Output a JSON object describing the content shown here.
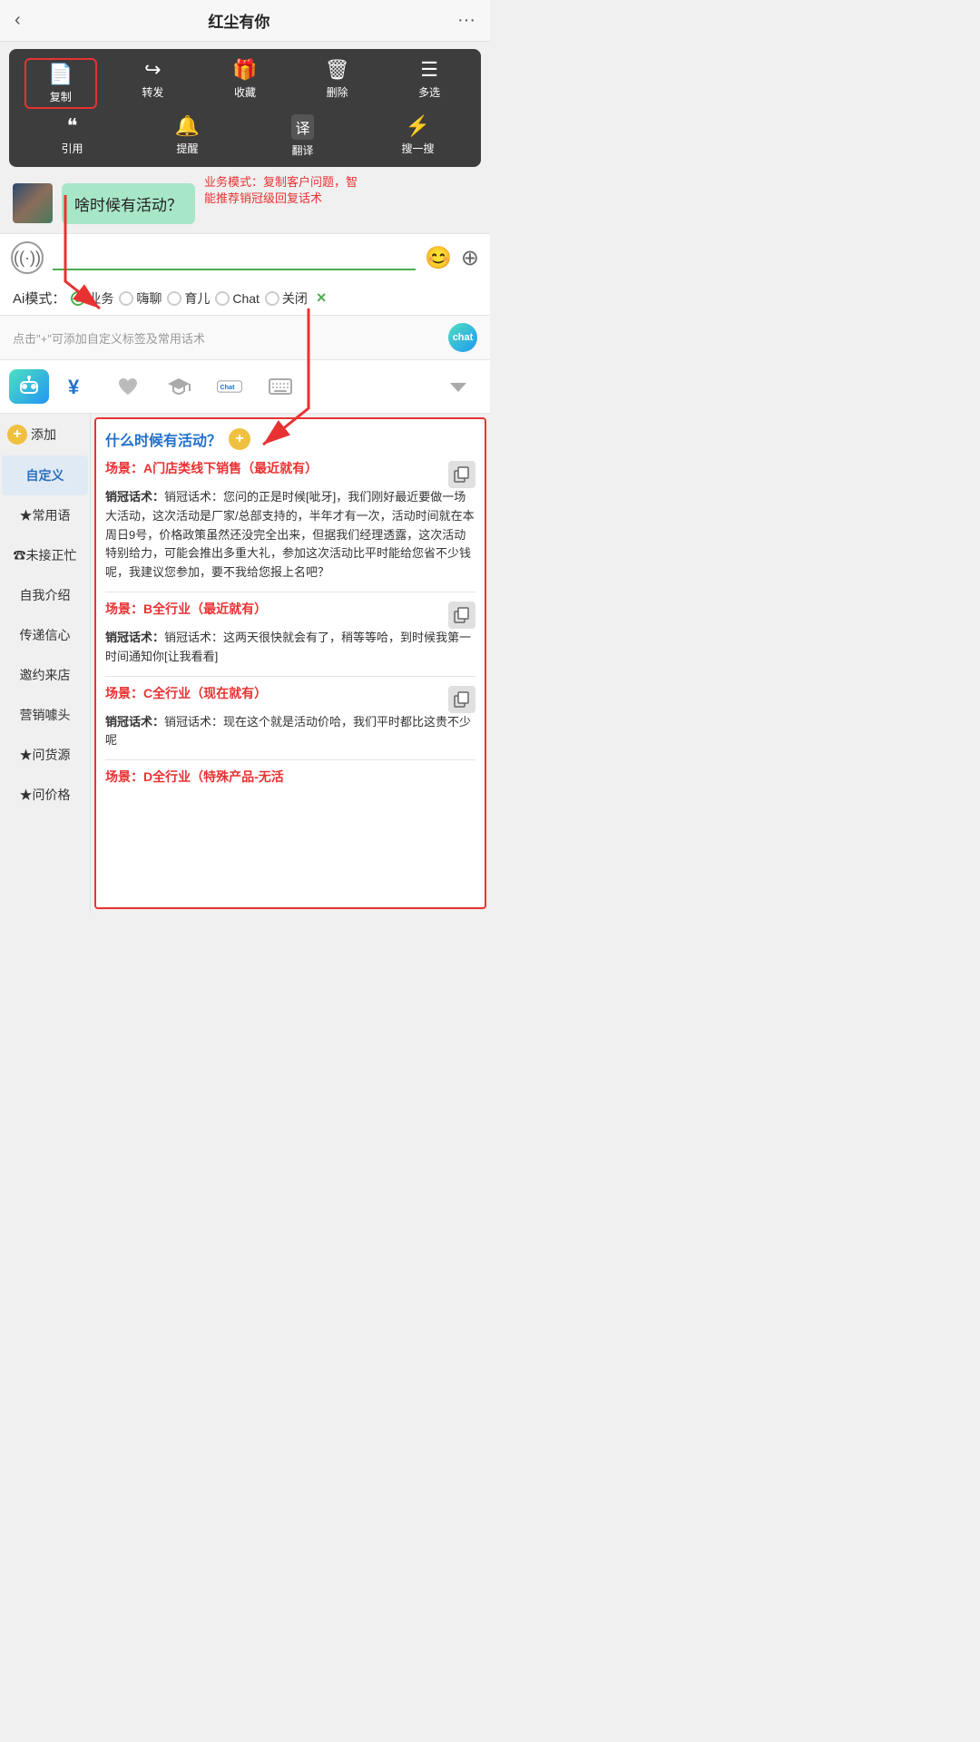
{
  "header": {
    "title": "红尘有你",
    "back_icon": "‹",
    "more_icon": "···"
  },
  "context_menu": {
    "row1": [
      {
        "icon": "📄",
        "label": "复制",
        "highlighted": true
      },
      {
        "icon": "↪",
        "label": "转发",
        "highlighted": false
      },
      {
        "icon": "🎁",
        "label": "收藏",
        "highlighted": false
      },
      {
        "icon": "🗑",
        "label": "删除",
        "highlighted": false
      },
      {
        "icon": "☰",
        "label": "多选",
        "highlighted": false
      }
    ],
    "row2": [
      {
        "icon": "❝",
        "label": "引用",
        "highlighted": false
      },
      {
        "icon": "🔔",
        "label": "提醒",
        "highlighted": false
      },
      {
        "icon": "译",
        "label": "翻译",
        "highlighted": false
      },
      {
        "icon": "⚡",
        "label": "搜一搜",
        "highlighted": false
      }
    ]
  },
  "chat": {
    "message": "啥时候有活动？",
    "annotation": "业务模式：复制客户问题，智能推荐销冠级回复话术"
  },
  "input": {
    "placeholder": "",
    "voice_label": "((·))",
    "emoji_label": "😊",
    "plus_label": "+"
  },
  "ai_modes": {
    "label": "Ai模式：",
    "modes": [
      {
        "id": "business",
        "label": "业务",
        "active": true
      },
      {
        "id": "chat_casual",
        "label": "嗨聊",
        "active": false
      },
      {
        "id": "parenting",
        "label": "育儿",
        "active": false
      },
      {
        "id": "chat",
        "label": "Chat",
        "active": false
      },
      {
        "id": "off",
        "label": "关闭",
        "active": false
      }
    ],
    "close_label": "×"
  },
  "hint_bar": {
    "text": "点击\"+\"可添加自定义标签及常用话术",
    "badge": "chat"
  },
  "toolbar": {
    "icons": [
      {
        "name": "chat-robot",
        "type": "chat"
      },
      {
        "name": "money",
        "type": "yen"
      },
      {
        "name": "heart",
        "type": "heart"
      },
      {
        "name": "graduation",
        "type": "grad"
      },
      {
        "name": "chat-text",
        "type": "chat-label"
      },
      {
        "name": "keyboard",
        "type": "keyboard"
      },
      {
        "name": "dropdown",
        "type": "arrow-down"
      }
    ]
  },
  "sidebar": {
    "add_label": "添加",
    "items": [
      {
        "id": "custom",
        "label": "自定义",
        "active": true
      },
      {
        "id": "common",
        "label": "★常用语",
        "active": false
      },
      {
        "id": "missed",
        "label": "☎未接正忙",
        "active": false
      },
      {
        "id": "intro",
        "label": "自我介绍",
        "active": false
      },
      {
        "id": "confidence",
        "label": "传递信心",
        "active": false
      },
      {
        "id": "invite",
        "label": "邀约来店",
        "active": false
      },
      {
        "id": "marketing",
        "label": "营销噱头",
        "active": false
      },
      {
        "id": "source",
        "label": "★问货源",
        "active": false
      },
      {
        "id": "price",
        "label": "★问价格",
        "active": false
      }
    ]
  },
  "right_panel": {
    "question": "什么时候有活动？",
    "scenes": [
      {
        "id": "A",
        "title": "场景：A门店类线下销售（最近就有）",
        "sales_text": "销冠话术：您问的正是时候[呲牙]，我们刚好最近要做一场大活动，这次活动是厂家/总部支持的，半年才有一次，活动时间就在本周日9号，价格政策虽然还没完全出来，但据我们经理透露，这次活动特别给力，可能会推出多重大礼，参加这次活动比平时能给您省不少钱呢，我建议您参加，要不我给您报上名吧？"
      },
      {
        "id": "B",
        "title": "场景：B全行业（最近就有）",
        "sales_text": "销冠话术：这两天很快就会有了，稍等等哈，到时候我第一时间通知你[让我看看]"
      },
      {
        "id": "C",
        "title": "场景：C全行业（现在就有）",
        "sales_text": "销冠话术：现在这个就是活动价哈，我们平时都比这贵不少呢"
      },
      {
        "id": "D",
        "title": "场景：D全行业（特殊产品-无活",
        "sales_text": ""
      }
    ]
  }
}
